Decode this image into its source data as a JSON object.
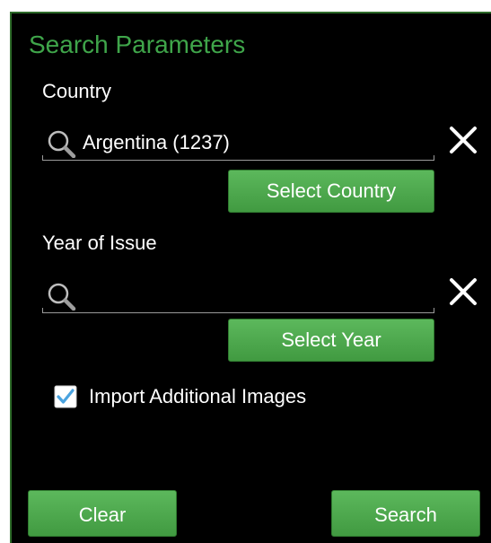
{
  "dialog": {
    "title": "Search Parameters"
  },
  "country": {
    "label": "Country",
    "value": "Argentina (1237)",
    "select_button": "Select Country"
  },
  "year": {
    "label": "Year of Issue",
    "value": "",
    "select_button": "Select Year"
  },
  "import_images": {
    "label": "Import Additional Images",
    "checked": true
  },
  "actions": {
    "clear_label": "Clear",
    "search_label": "Search"
  },
  "icons": {
    "search": "search-icon",
    "clear": "close-icon",
    "check": "checkmark-icon"
  },
  "colors": {
    "title": "#3fa54a",
    "button": "#4caf50",
    "checkbox": "#4aa3df",
    "background": "#000000"
  }
}
